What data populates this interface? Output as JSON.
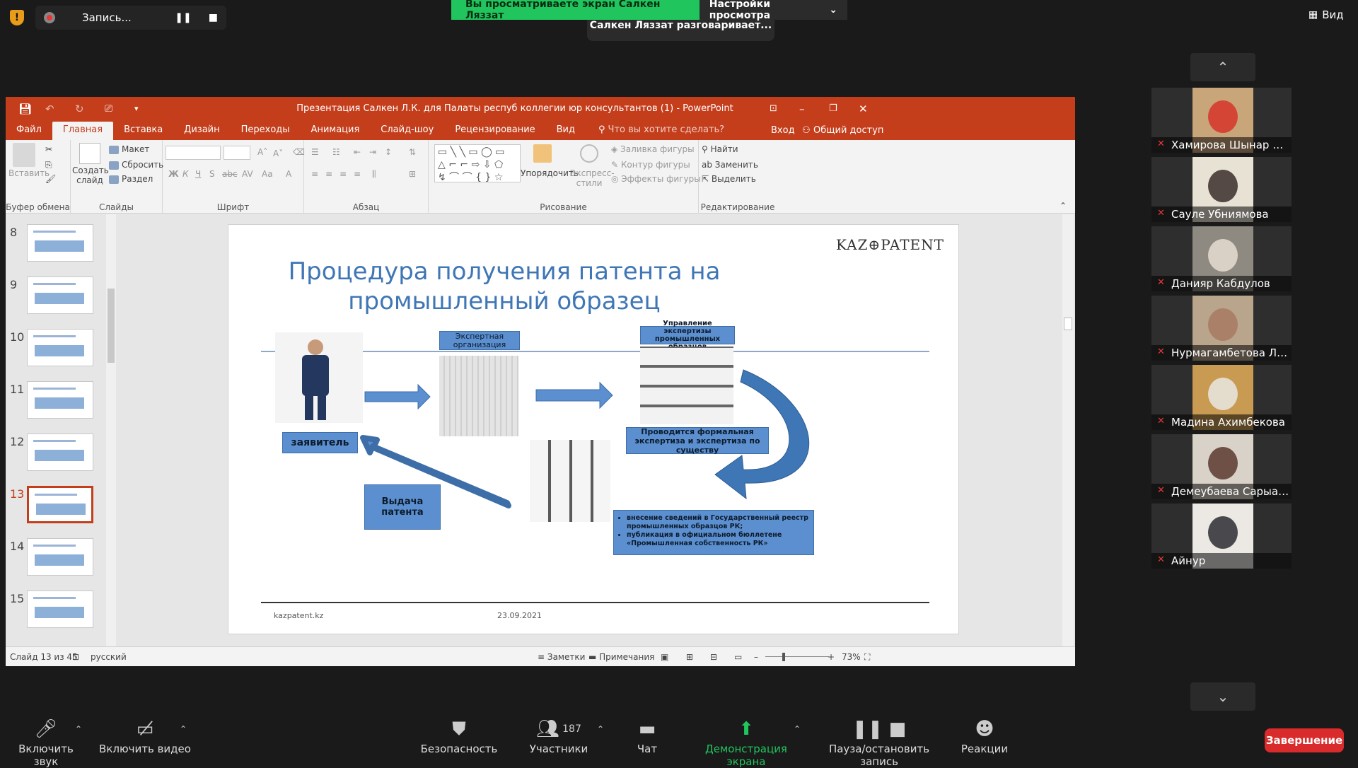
{
  "zoom": {
    "recording_label": "Запись...",
    "security_badge": "!",
    "share_banner": "Вы просматриваете экран Салкен Ляззат",
    "view_options": "Настройки просмотра",
    "active_speaker": "Салкен Ляззат разговаривает...",
    "view_label": "Вид",
    "gallery_up": "⌃",
    "gallery_down": "⌄",
    "participants": [
      {
        "name": "Хамирова Шынар Жу...",
        "bg": "#c9a57a",
        "face": "#d7342a"
      },
      {
        "name": "Сауле Убниямова",
        "bg": "#e8e2d4",
        "face": "#3a2e2a"
      },
      {
        "name": "Данияр Кабдулов",
        "bg": "#8e8a82",
        "face": "#e6ddd2"
      },
      {
        "name": "Нурмагамбетова Ляззат",
        "bg": "#b9a48c",
        "face": "#a87a62"
      },
      {
        "name": "Мадина Ахимбекова",
        "bg": "#c89a52",
        "face": "#e9e7e2"
      },
      {
        "name": "Демеубаева Сарыалка",
        "bg": "#d9d2c9",
        "face": "#5a3a30"
      },
      {
        "name": "Айнур",
        "bg": "#ece9e4",
        "face": "#2b2b33"
      }
    ],
    "toolbar": {
      "mute": "Включить звук",
      "video": "Включить видео",
      "security": "Безопасность",
      "participants": "Участники",
      "participants_count": "187",
      "chat": "Чат",
      "share": "Демонстрация экрана",
      "record": "Пауза/остановить запись",
      "reactions": "Реакции",
      "end": "Завершение"
    }
  },
  "ppt": {
    "window_title": "Презентация Салкен Л.К. для Палаты респуб коллегии юр консультантов (1) - PowerPoint",
    "tabs": [
      "Файл",
      "Главная",
      "Вставка",
      "Дизайн",
      "Переходы",
      "Анимация",
      "Слайд-шоу",
      "Рецензирование",
      "Вид"
    ],
    "tell_me": "Что вы хотите сделать?",
    "login": "Вход",
    "share": "Общий доступ",
    "ribbon": {
      "paste": "Вставить",
      "clipboard": "Буфер обмена",
      "new_slide": "Создать слайд",
      "layout": "Макет",
      "reset": "Сбросить",
      "section": "Раздел",
      "slides": "Слайды",
      "font": "Шрифт",
      "paragraph": "Абзац",
      "arrange": "Упорядочить",
      "quick_styles": "Экспресс-стили",
      "shape_fill": "Заливка фигуры",
      "shape_outline": "Контур фигуры",
      "shape_effects": "Эффекты фигуры",
      "drawing": "Рисование",
      "find": "Найти",
      "replace": "Заменить",
      "select": "Выделить",
      "editing": "Редактирование"
    },
    "thumbnails": [
      {
        "num": "8"
      },
      {
        "num": "9"
      },
      {
        "num": "10"
      },
      {
        "num": "11"
      },
      {
        "num": "12"
      },
      {
        "num": "13",
        "current": true
      },
      {
        "num": "14"
      },
      {
        "num": "15"
      }
    ],
    "slide": {
      "title": "Процедура получения патента на промышленный образец",
      "logo": "KAZ⊕PATENT",
      "expert_org": "Экспертная организация",
      "department": "Управление экспертизы промышленных образцов",
      "applicant": "заявитель",
      "examination": "Проводится формальная экспертиза и экспертиза по существу",
      "issuance": "Выдача патента",
      "bullets": [
        "внесение сведений в Государственный реестр промышленных образцов РК;",
        "публикация в официальном бюллетене «Промышленная собственность РК»"
      ],
      "footer_left": "kazpatent.kz",
      "footer_date": "23.09.2021"
    },
    "status": {
      "slide_info": "Слайд 13 из 45",
      "language": "русский",
      "notes": "Заметки",
      "comments": "Примечания",
      "zoom": "73%"
    }
  }
}
